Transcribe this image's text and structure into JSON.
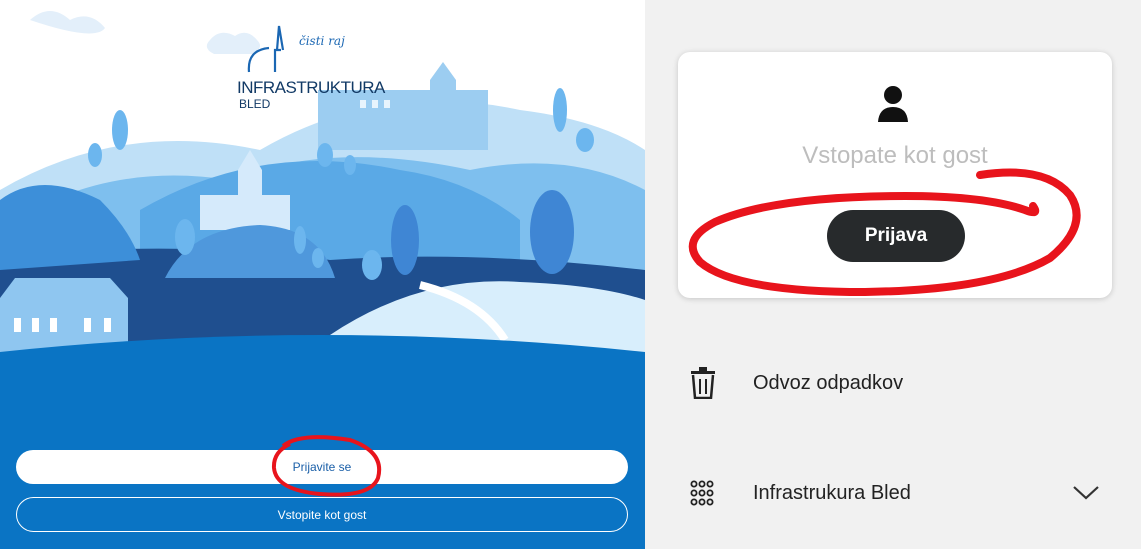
{
  "logo": {
    "tagline": "čisti raj",
    "name": "INFRASTRUKTURA",
    "place": "BLED"
  },
  "auth": {
    "login_label": "Prijavite se",
    "guest_label": "Vstopite kot gost"
  },
  "sidebar": {
    "user_status": "Vstopate kot gost",
    "login_button": "Prijava",
    "items": [
      {
        "label": "Odvoz odpadkov",
        "icon": "trash-icon"
      },
      {
        "label": "Infrastrukura Bled",
        "icon": "grid-dots-icon",
        "expandable": true
      }
    ]
  },
  "colors": {
    "primary_blue": "#0a74c4",
    "annotation_red": "#e8141c",
    "dark_button": "#272a2c"
  }
}
